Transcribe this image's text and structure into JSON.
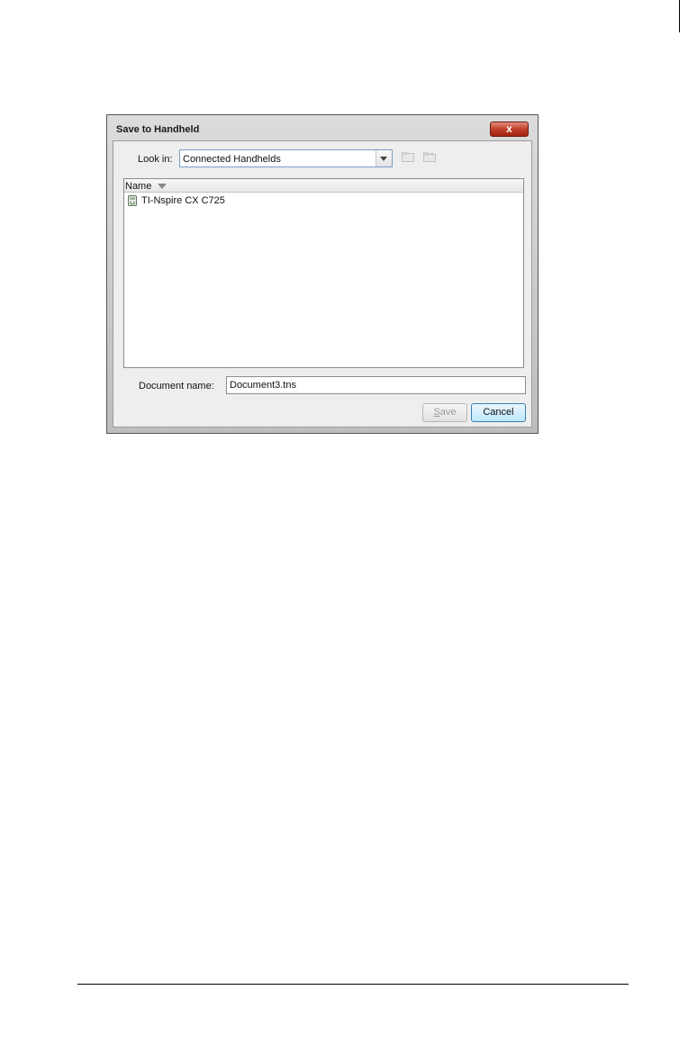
{
  "dialog": {
    "title": "Save to Handheld",
    "close_label": "x",
    "look_in": {
      "label": "Look in:",
      "value": "Connected Handhelds"
    },
    "toolbar_icons": [
      "up-folder-icon",
      "new-folder-icon"
    ],
    "file_list": {
      "column_name": "Name",
      "sort": "descending",
      "items": [
        {
          "label": "TI-Nspire CX C725",
          "icon": "handheld-icon"
        }
      ]
    },
    "document_name": {
      "label": "Document name:",
      "value": "Document3.tns"
    },
    "buttons": {
      "save_mnemonic": "S",
      "save_rest": "ave",
      "save_enabled": false,
      "cancel": "Cancel"
    }
  },
  "colors": {
    "close_button": "#c2402a",
    "cancel_button": "#bee6fd",
    "combo_border": "#7a9cc8"
  }
}
